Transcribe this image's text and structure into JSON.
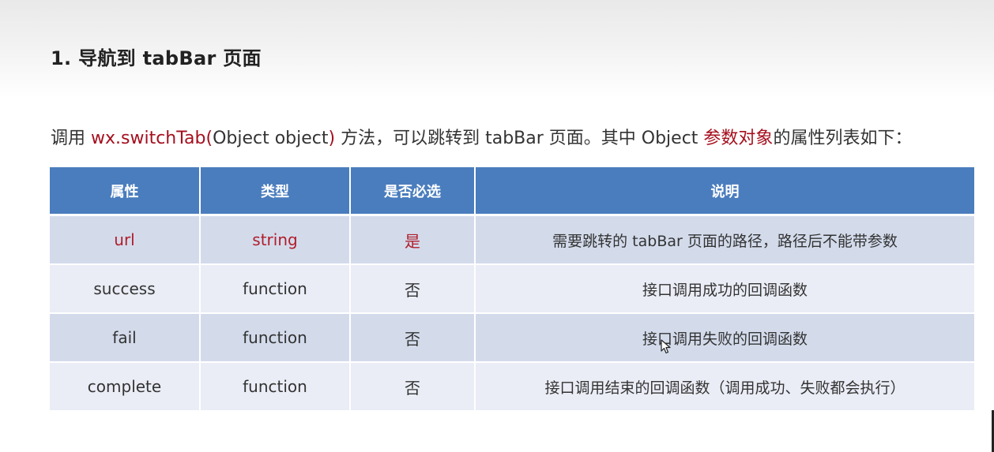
{
  "heading": "1. 导航到 tabBar 页面",
  "intro": {
    "part1": "调用 ",
    "api": "wx.switchTab(",
    "param": "Object object",
    "api_close": ")",
    "part2": " 方法，可以跳转到 tabBar 页面。其中 Object ",
    "highlight": "参数对象",
    "part3": "的属性列表如下："
  },
  "table": {
    "headers": [
      "属性",
      "类型",
      "是否必选",
      "说明"
    ],
    "rows": [
      {
        "prop": "url",
        "type": "string",
        "required": "是",
        "desc": "需要跳转的 tabBar 页面的路径，路径后不能带参数"
      },
      {
        "prop": "success",
        "type": "function",
        "required": "否",
        "desc": "接口调用成功的回调函数"
      },
      {
        "prop": "fail",
        "type": "function",
        "required": "否",
        "desc": "接口调用失败的回调函数"
      },
      {
        "prop": "complete",
        "type": "function",
        "required": "否",
        "desc": "接口调用结束的回调函数（调用成功、失败都会执行）"
      }
    ]
  },
  "colors": {
    "header_bg": "#4a7dbd",
    "row_dark": "#d3dbeb",
    "row_light": "#eaedf6",
    "accent_red": "#a50f1e"
  },
  "icons": [
    "mouse-cursor-icon"
  ]
}
